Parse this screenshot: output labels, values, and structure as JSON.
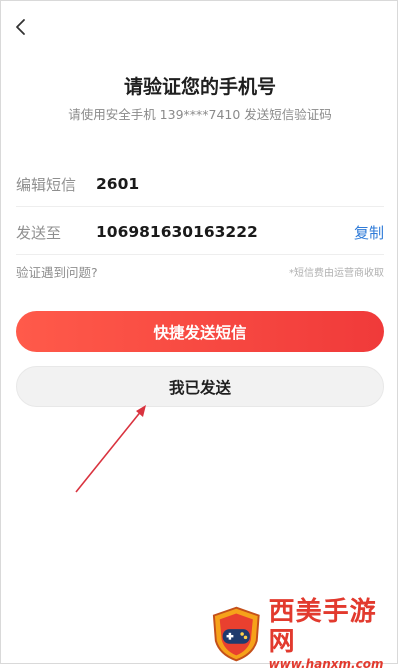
{
  "header": {
    "back_icon": "chevron-left-icon",
    "title": "请验证您的手机号",
    "subtitle": "请使用安全手机 139****7410 发送短信验证码"
  },
  "form": {
    "sms_label": "编辑短信",
    "sms_value": "2601",
    "to_label": "发送至",
    "to_value": "106981630163222",
    "copy_label": "复制",
    "help_link": "验证遇到问题?",
    "fee_note": "*短信费由运营商收取"
  },
  "buttons": {
    "quick_send": "快捷发送短信",
    "already_sent": "我已发送"
  },
  "watermark": {
    "name": "西美手游网",
    "url": "www.hanxm.com"
  },
  "colors": {
    "accent_red": "#f04a3c",
    "link_blue": "#2f7bd8",
    "annotation_arrow": "#d9333f"
  }
}
